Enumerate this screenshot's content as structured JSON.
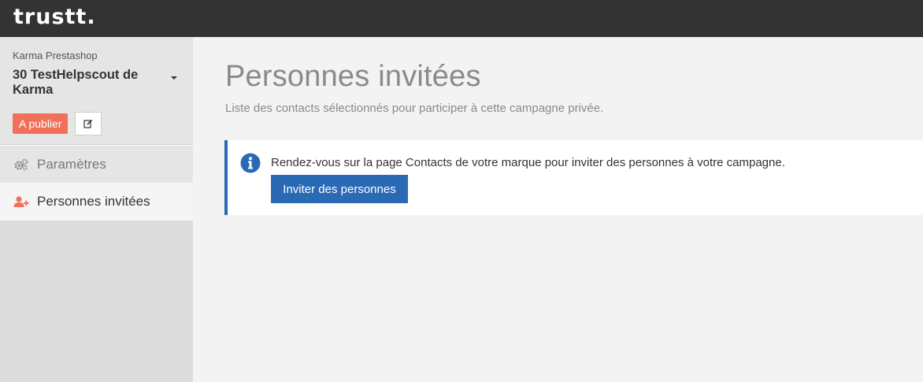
{
  "header": {
    "logo_text": "trustt."
  },
  "sidebar": {
    "brand": "Karma Prestashop",
    "campaign_name": "30 TestHelpscout de Karma",
    "status_badge": "A publier",
    "nav": [
      {
        "label": "Paramètres",
        "icon": "gears-icon"
      },
      {
        "label": "Personnes invitées",
        "icon": "user-plus-icon"
      }
    ]
  },
  "main": {
    "title": "Personnes invitées",
    "subtitle": "Liste des contacts sélectionnés pour participer à cette campagne privée.",
    "info": {
      "message": "Rendez-vous sur la page Contacts de votre marque pour inviter des personnes à votre campagne.",
      "button_label": "Inviter des personnes"
    }
  },
  "colors": {
    "topbar": "#333333",
    "accent_blue": "#2a69b4",
    "badge_red": "#f2705a",
    "invite_icon": "#f2705a"
  }
}
